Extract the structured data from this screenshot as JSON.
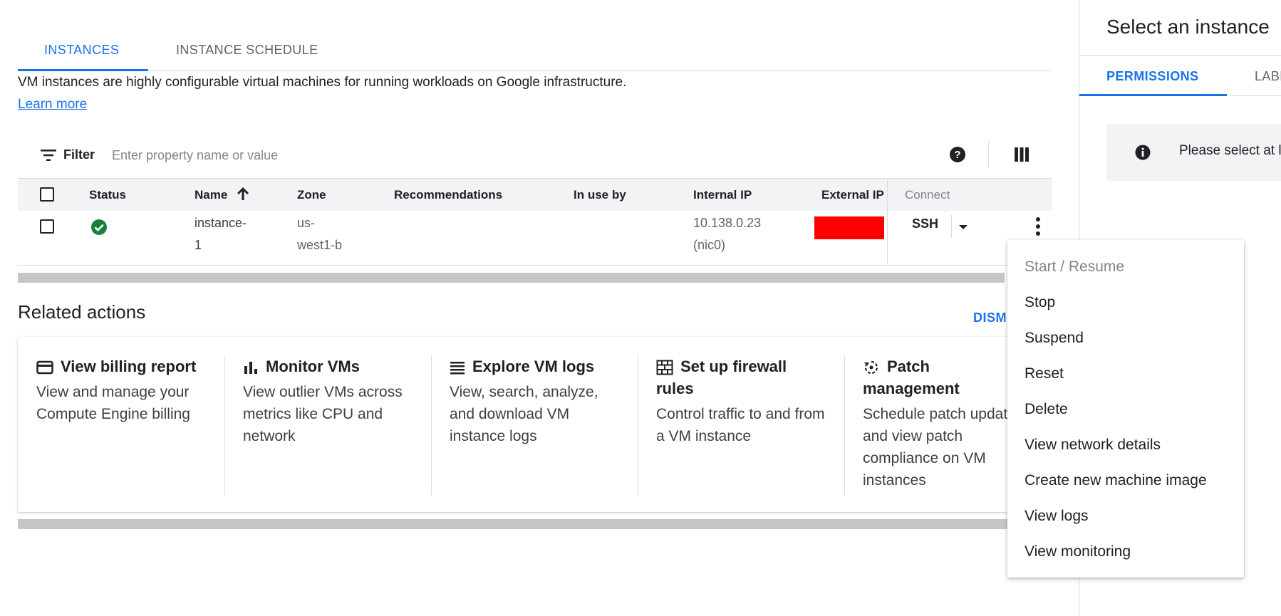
{
  "tabs": [
    {
      "label": "INSTANCES",
      "active": true
    },
    {
      "label": "INSTANCE SCHEDULE",
      "active": false
    }
  ],
  "description": {
    "text": "VM instances are highly configurable virtual machines for running workloads on Google infrastructure.",
    "link": "Learn more"
  },
  "filter": {
    "label": "Filter",
    "placeholder": "Enter property name or value"
  },
  "table": {
    "headers": {
      "status": "Status",
      "name": "Name",
      "zone": "Zone",
      "recommendations": "Recommendations",
      "in_use_by": "In use by",
      "internal_ip": "Internal IP",
      "external_ip": "External IP",
      "connect": "Connect"
    },
    "rows": [
      {
        "status": "running",
        "name_line1": "instance-",
        "name_line2": "1",
        "zone_line1": "us-",
        "zone_line2": "west1-b",
        "internal_ip_line1": "10.138.0.23",
        "internal_ip_line2": "(nic0)",
        "connect": "SSH"
      }
    ]
  },
  "related": {
    "title": "Related actions",
    "dismiss": "DISMISS",
    "cards": [
      {
        "icon": "billing-card-icon",
        "title": "View billing report",
        "description": "View and manage your Compute Engine billing"
      },
      {
        "icon": "bar-chart-icon",
        "title": "Monitor VMs",
        "description": "View outlier VMs across metrics like CPU and network"
      },
      {
        "icon": "list-lines-icon",
        "title": "Explore VM logs",
        "description": "View, search, analyze, and download VM instance logs"
      },
      {
        "icon": "firewall-icon",
        "title": "Set up firewall rules",
        "description": "Control traffic to and from a VM instance"
      },
      {
        "icon": "patch-sync-icon",
        "title": "Patch management",
        "description": "Schedule patch updates and view patch compliance on VM instances"
      }
    ]
  },
  "menu": {
    "items": [
      {
        "label": "Start / Resume",
        "disabled": true
      },
      {
        "label": "Stop",
        "disabled": false
      },
      {
        "label": "Suspend",
        "disabled": false
      },
      {
        "label": "Reset",
        "disabled": false
      },
      {
        "label": "Delete",
        "disabled": false
      },
      {
        "label": "View network details",
        "disabled": false
      },
      {
        "label": "Create new machine image",
        "disabled": false
      },
      {
        "label": "View logs",
        "disabled": false
      },
      {
        "label": "View monitoring",
        "disabled": false
      }
    ]
  },
  "panel": {
    "title": "Select an instance",
    "tabs": [
      {
        "label": "PERMISSIONS",
        "active": true
      },
      {
        "label": "LABELS",
        "active": false
      }
    ],
    "info": "Please select at least one resource."
  },
  "colors": {
    "accent": "#1a73e8",
    "status_ok": "#188038",
    "redacted": "#ff0000"
  }
}
